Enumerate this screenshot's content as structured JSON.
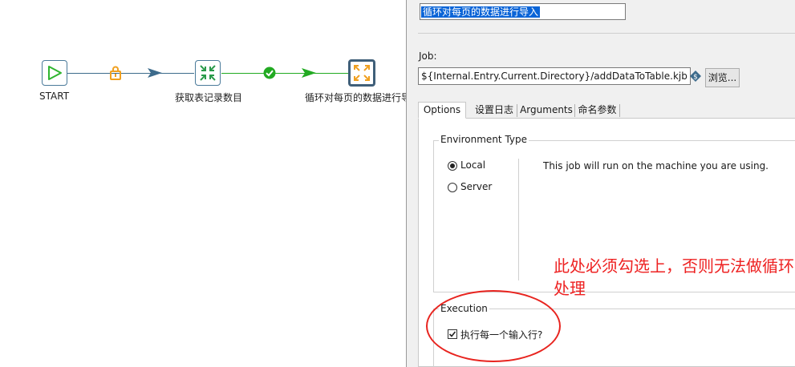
{
  "canvas": {
    "nodes": [
      {
        "label": "START",
        "icon": "play-icon"
      },
      {
        "label": "获取表记录数目",
        "icon": "arrows-inward-icon"
      },
      {
        "label": "循环对每页的数据进行导入",
        "icon": "arrows-outward-icon"
      }
    ],
    "hops": [
      {
        "badge": "lock-icon",
        "color": "#3d6b8c",
        "badge_color": "#f0a020"
      },
      {
        "badge": "check-circle-icon",
        "color": "#22aa22",
        "badge_color": "#22aa22"
      }
    ]
  },
  "dialog": {
    "name_value": "循环对每页的数据进行导入",
    "job_label": "Job:",
    "job_value": "${Internal.Entry.Current.Directory}/addDataToTable.kjb",
    "variable_icon": "variable-diamond-icon",
    "browse_label": "浏览...",
    "tabs": [
      {
        "label": "Options",
        "active": true
      },
      {
        "label": "设置日志"
      },
      {
        "label": "Arguments"
      },
      {
        "label": "命名参数"
      }
    ],
    "env_group_title": "Environment Type",
    "env_options": [
      {
        "label": "Local",
        "selected": true
      },
      {
        "label": "Server",
        "selected": false
      }
    ],
    "env_description": "This job will run on the machine you are using.",
    "execution_group_title": "Execution",
    "execute_each_label": "执行每一个输入行?",
    "execute_each_checked": true
  },
  "annotation": {
    "text": "此处必须勾选上，否则无法做循环处理",
    "color": "#ee2222"
  },
  "colors": {
    "selection_bg": "#0a64d7",
    "node_border": "#4a7a9a"
  }
}
